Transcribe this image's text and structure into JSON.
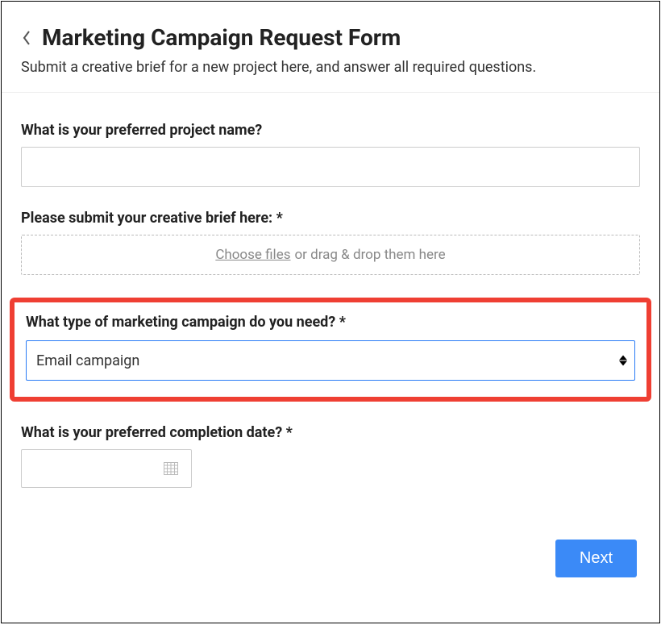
{
  "header": {
    "title": "Marketing Campaign Request Form",
    "subtitle": "Submit a creative brief for a new project here, and answer all required questions."
  },
  "fields": {
    "project_name": {
      "label": "What is your preferred project name?",
      "value": ""
    },
    "creative_brief": {
      "label": "Please submit your creative brief here: *",
      "choose_text": "Choose files",
      "drop_text": " or drag & drop them here"
    },
    "campaign_type": {
      "label": "What type of marketing campaign do you need? *",
      "selected": "Email campaign"
    },
    "completion_date": {
      "label": "What is your preferred completion date? *",
      "value": ""
    }
  },
  "footer": {
    "next_label": "Next"
  },
  "colors": {
    "highlight_border": "#ef3f33",
    "select_active_border": "#2a7cf6",
    "primary_button": "#3b8af7"
  }
}
